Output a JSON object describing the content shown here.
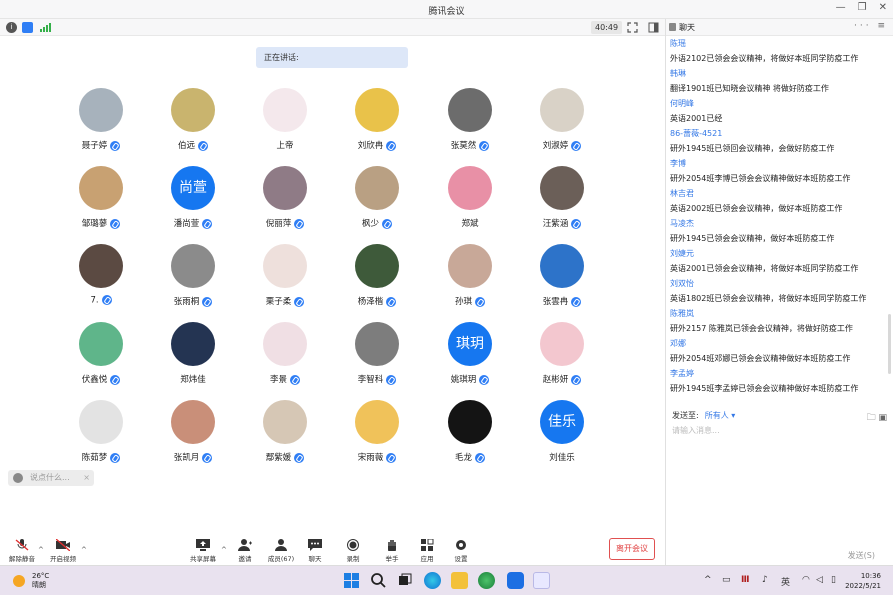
{
  "window": {
    "title": "腾讯会议",
    "controls": [
      "—",
      "❐",
      "✕"
    ]
  },
  "status": {
    "clock": "40:49"
  },
  "speaking": "正在讲话:",
  "participants": [
    {
      "name": "聂子婷",
      "mic": true,
      "avatar_color": "#a7b2bc",
      "text": ""
    },
    {
      "name": "伯远",
      "mic": true,
      "avatar_color": "#c9b46e",
      "text": ""
    },
    {
      "name": "上帝",
      "mic": false,
      "avatar_color": "#f4e8ec",
      "text": ""
    },
    {
      "name": "刘欣冉",
      "mic": true,
      "avatar_color": "#e9c24a",
      "text": ""
    },
    {
      "name": "张莫然",
      "mic": true,
      "avatar_color": "#6c6c6c",
      "text": ""
    },
    {
      "name": "刘淑婷",
      "mic": true,
      "avatar_color": "#d9d2c7",
      "text": ""
    },
    {
      "name": "邹璐蓼",
      "mic": true,
      "avatar_color": "#c8a172",
      "text": ""
    },
    {
      "name": "潘尚萱",
      "mic": true,
      "avatar_color": "#1677f0",
      "text": "尚萱"
    },
    {
      "name": "倪丽萍",
      "mic": true,
      "avatar_color": "#8f7b86",
      "text": ""
    },
    {
      "name": "枫少",
      "mic": true,
      "avatar_color": "#b9a083",
      "text": ""
    },
    {
      "name": "郑斌",
      "mic": false,
      "avatar_color": "#e890a6",
      "text": ""
    },
    {
      "name": "汪紫涵",
      "mic": true,
      "avatar_color": "#6b5f58",
      "text": ""
    },
    {
      "name": "7.",
      "mic": true,
      "avatar_color": "#5b4a42",
      "text": ""
    },
    {
      "name": "张雨桐",
      "mic": true,
      "avatar_color": "#8b8b8b",
      "text": ""
    },
    {
      "name": "栗子柔",
      "mic": true,
      "avatar_color": "#eee0dc",
      "text": ""
    },
    {
      "name": "杨泽楷",
      "mic": true,
      "avatar_color": "#3e5a3a",
      "text": ""
    },
    {
      "name": "孙琪",
      "mic": true,
      "avatar_color": "#c8a898",
      "text": ""
    },
    {
      "name": "张雲冉",
      "mic": true,
      "avatar_color": "#2d73c9",
      "text": ""
    },
    {
      "name": "伏鑫悦",
      "mic": true,
      "avatar_color": "#5fb58a",
      "text": ""
    },
    {
      "name": "郑炜佳",
      "mic": false,
      "avatar_color": "#243452",
      "text": ""
    },
    {
      "name": "李景",
      "mic": true,
      "avatar_color": "#f0dfe4",
      "text": ""
    },
    {
      "name": "李智科",
      "mic": true,
      "avatar_color": "#7d7d7d",
      "text": ""
    },
    {
      "name": "姚琪玥",
      "mic": true,
      "avatar_color": "#1677f0",
      "text": "琪玥"
    },
    {
      "name": "赵彬妍",
      "mic": true,
      "avatar_color": "#f3c7cf",
      "text": ""
    },
    {
      "name": "陈茹梦",
      "mic": true,
      "avatar_color": "#e3e3e3",
      "text": ""
    },
    {
      "name": "张凯月",
      "mic": true,
      "avatar_color": "#c98f79",
      "text": ""
    },
    {
      "name": "鄢紫媛",
      "mic": true,
      "avatar_color": "#d6c7b5",
      "text": ""
    },
    {
      "name": "宋雨薇",
      "mic": true,
      "avatar_color": "#f0c25a",
      "text": ""
    },
    {
      "name": "毛龙",
      "mic": true,
      "avatar_color": "#141414",
      "text": ""
    },
    {
      "name": "刘佳乐",
      "mic": false,
      "avatar_color": "#1677f0",
      "text": "佳乐"
    }
  ],
  "ask_placeholder": "说点什么...",
  "toolbar": {
    "mute": "解除静音",
    "video": "开启视频",
    "share": "共享屏幕",
    "invite": "邀请",
    "members": "成员(67)",
    "chat": "聊天",
    "record": "录制",
    "hand": "举手",
    "apps": "应用",
    "settings": "设置",
    "leave": "离开会议"
  },
  "chat": {
    "title": "聊天",
    "messages": [
      {
        "sender": "陈瑶",
        "text": "外语2102已领会会议精神，将做好本班同学防疫工作"
      },
      {
        "sender": "韩琳",
        "text": "翻译1901班已知晓会议精神 将做好防疫工作"
      },
      {
        "sender": "何明峰",
        "text": "英语2001已经"
      },
      {
        "sender": "86-蔷薇-4521",
        "text": "研外1945班已领回会议精神，会做好防疫工作"
      },
      {
        "sender": "李博",
        "text": "研外2054班李博已领会会议精神做好本班防疫工作"
      },
      {
        "sender": "林吉君",
        "text": "英语2002班已领会会议精神，做好本班防疫工作"
      },
      {
        "sender": "马凌杰",
        "text": "研外1945已领会会议精神，做好本班防疫工作"
      },
      {
        "sender": "刘婕元",
        "text": "英语2001已领会会议精神，将做好本班同学防疫工作"
      },
      {
        "sender": "刘双怡",
        "text": "英语1802班已领会会议精神，将做好本班同学防疫工作"
      },
      {
        "sender": "陈雅岚",
        "text": "研外2157 陈雅岚已领会会议精神，将做好防疫工作"
      },
      {
        "sender": "邓娜",
        "text": "研外2054班邓娜已领会会议精神做好本班防疫工作"
      },
      {
        "sender": "李孟婷",
        "text": "研外1945班李孟婷已领会会议精神做好本班防疫工作"
      }
    ],
    "send_to_label": "发送至:",
    "send_to_value": "所有人 ▾",
    "input_placeholder": "请输入消息...",
    "send": "发送(S)"
  },
  "taskbar": {
    "temp": "26°C",
    "weather": "晴朗",
    "ime": "英",
    "time": "10:36",
    "date": "2022/5/21"
  }
}
